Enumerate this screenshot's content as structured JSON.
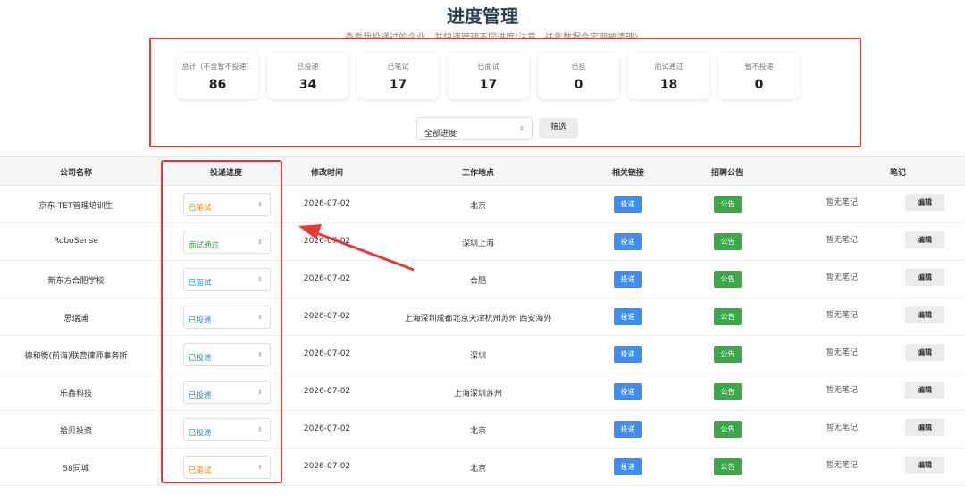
{
  "page": {
    "title": "进度管理",
    "subtitle": "查看我投递过的企业，并快速管理不同进度(注意，往年数据会定期被清理)。"
  },
  "stats": [
    {
      "label": "总计（不含暂不投递）",
      "value": "86"
    },
    {
      "label": "已投递",
      "value": "34"
    },
    {
      "label": "已笔试",
      "value": "17"
    },
    {
      "label": "已面试",
      "value": "17"
    },
    {
      "label": "已挂",
      "value": "0"
    },
    {
      "label": "面试通过",
      "value": "18"
    },
    {
      "label": "暂不投递",
      "value": "0"
    }
  ],
  "filter": {
    "selected": "全部进度",
    "button": "筛选"
  },
  "table": {
    "headers": {
      "company": "公司名称",
      "status": "投递进度",
      "modified": "修改时间",
      "location": "工作地点",
      "links": "相关链接",
      "notice": "招聘公告",
      "notes": "笔记"
    },
    "rows": [
      {
        "company": "京东-TET管理培训生",
        "status": "已笔试",
        "date": "2026-07-02",
        "location": "北京",
        "apply": "投递",
        "notice": "公告",
        "note": "暂无笔记",
        "edit": "编辑"
      },
      {
        "company": "RoboSense",
        "status": "面试通过",
        "date": "2026-07-02",
        "location": "深圳上海",
        "apply": "投递",
        "notice": "公告",
        "note": "暂无笔记",
        "edit": "编辑"
      },
      {
        "company": "新东方合肥学校",
        "status": "已面试",
        "date": "2026-07-02",
        "location": "合肥",
        "apply": "投递",
        "notice": "公告",
        "note": "暂无笔记",
        "edit": "编辑"
      },
      {
        "company": "思瑞浦",
        "status": "已投递",
        "date": "2026-07-02",
        "location": "上海深圳成都北京天津杭州苏州 西安海外",
        "apply": "投递",
        "notice": "公告",
        "note": "暂无笔记",
        "edit": "编辑"
      },
      {
        "company": "德和衡(前海)联营律师事务所",
        "status": "已投递",
        "date": "2026-07-02",
        "location": "深圳",
        "apply": "投递",
        "notice": "公告",
        "note": "暂无笔记",
        "edit": "编辑"
      },
      {
        "company": "乐鑫科技",
        "status": "已投递",
        "date": "2026-07-02",
        "location": "上海深圳苏州",
        "apply": "投递",
        "notice": "公告",
        "note": "暂无笔记",
        "edit": "编辑"
      },
      {
        "company": "拾贝投资",
        "status": "已投递",
        "date": "2026-07-02",
        "location": "北京",
        "apply": "投递",
        "notice": "公告",
        "note": "暂无笔记",
        "edit": "编辑"
      },
      {
        "company": "58同城",
        "status": "已笔试",
        "date": "2026-07-02",
        "location": "北京",
        "apply": "投递",
        "notice": "公告",
        "note": "暂无笔记",
        "edit": "编辑"
      }
    ]
  },
  "colors": {
    "status_written_test": "#e8891c",
    "status_passed": "#3ba84a",
    "status_applied": "#2a8fc9",
    "highlight_red": "#e53935",
    "apply_button": "#3d8ef0",
    "notice_button": "#3ba84a"
  }
}
